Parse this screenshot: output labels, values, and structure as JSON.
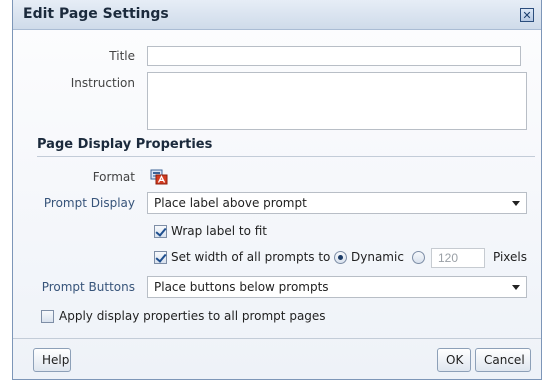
{
  "dialog": {
    "title": "Edit Page Settings",
    "close_icon": "close-icon"
  },
  "fields": {
    "title_label": "Title",
    "title_value": "",
    "instruction_label": "Instruction",
    "instruction_value": ""
  },
  "section": {
    "heading": "Page Display Properties"
  },
  "format": {
    "label": "Format",
    "icon": "format-icon"
  },
  "prompt_display": {
    "label": "Prompt Display",
    "selected": "Place label above prompt"
  },
  "wrap_label": {
    "label": "Wrap label to fit",
    "checked": true
  },
  "set_width": {
    "label": "Set width of all prompts to",
    "checked": true,
    "dynamic_label": "Dynamic",
    "dynamic_selected": true,
    "fixed_value": "120",
    "pixels_label": "Pixels"
  },
  "prompt_buttons": {
    "label": "Prompt Buttons",
    "selected": "Place buttons below prompts"
  },
  "apply_all": {
    "label": "Apply display properties to all prompt pages",
    "checked": false
  },
  "footer": {
    "help_label": "Help",
    "ok_label": "OK",
    "cancel_label": "Cancel"
  }
}
